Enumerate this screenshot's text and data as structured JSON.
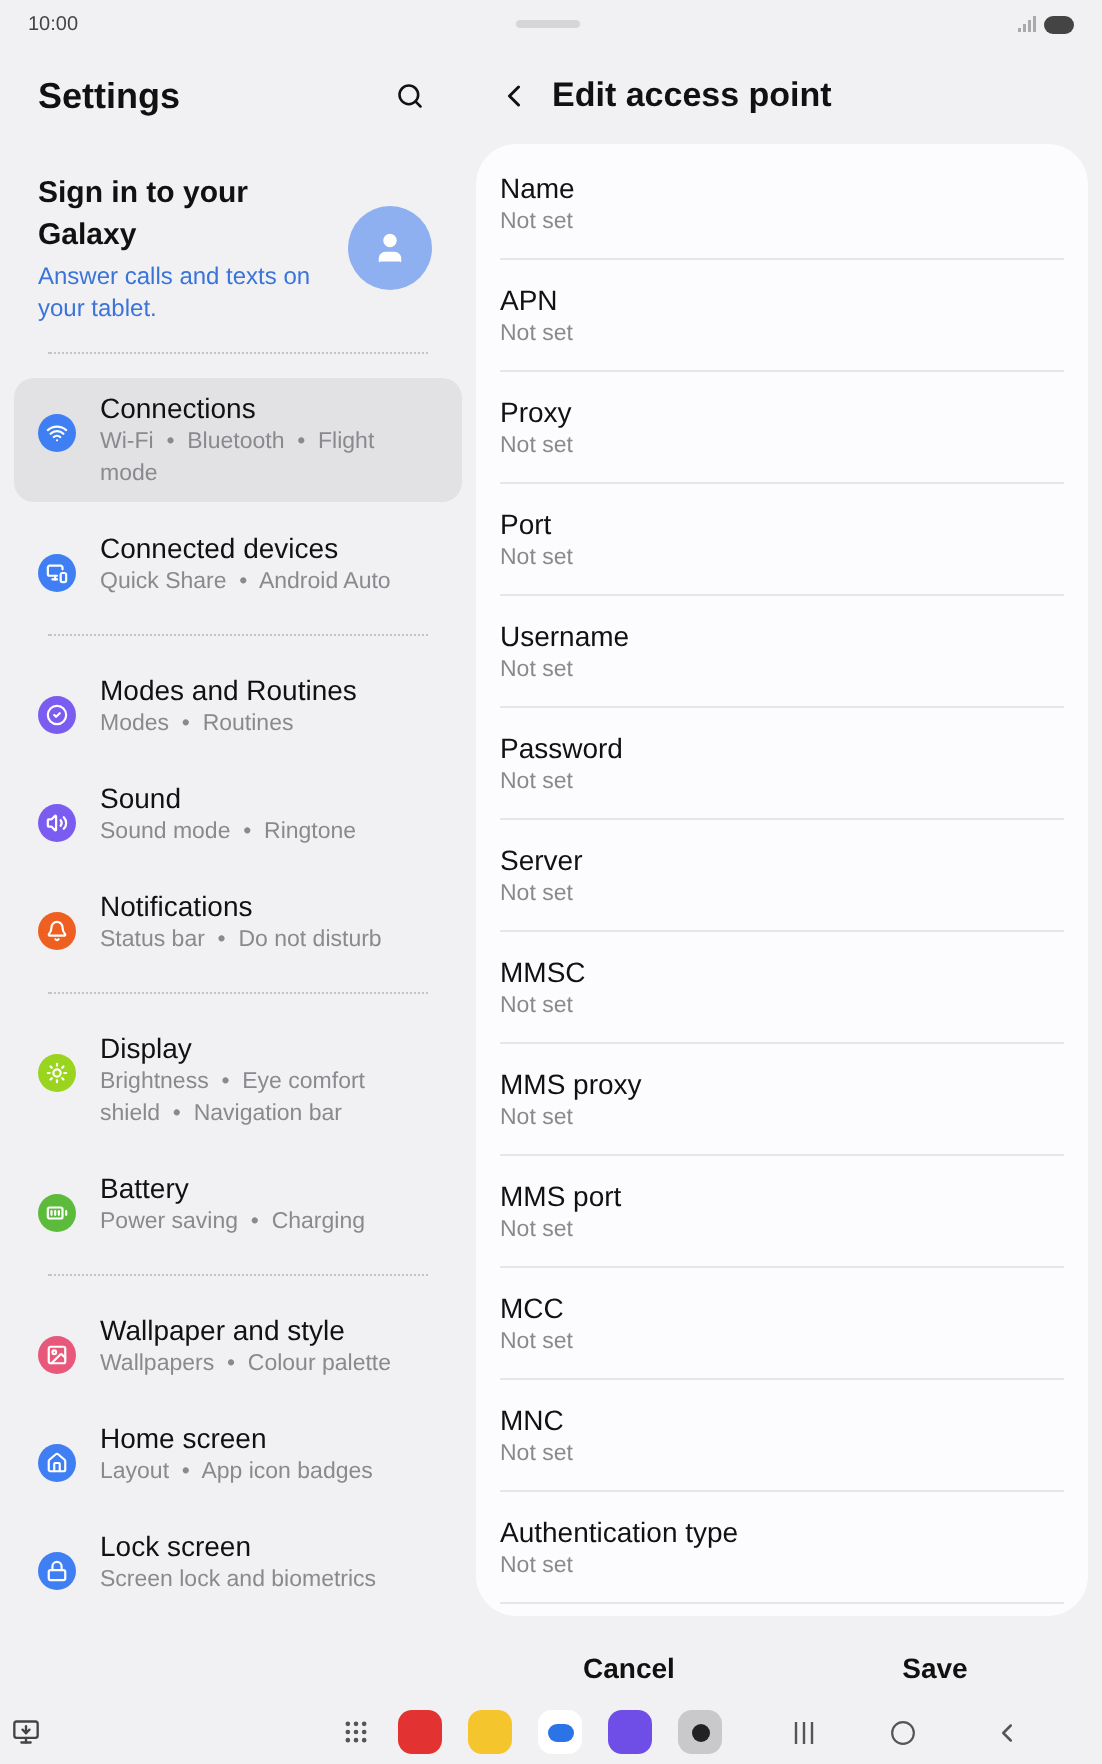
{
  "status_bar": {
    "time": "10:00"
  },
  "settings": {
    "title": "Settings",
    "account": {
      "title": "Sign in to your Galaxy",
      "subtitle": "Answer calls and texts on your tablet."
    },
    "groups": [
      [
        {
          "title": "Connections",
          "subtitle": "Wi-Fi  •  Bluetooth  •  Flight mode",
          "color": "#3f7ff3",
          "selected": true
        },
        {
          "title": "Connected devices",
          "subtitle": "Quick Share  •  Android Auto",
          "color": "#3f7ff3",
          "selected": false
        }
      ],
      [
        {
          "title": "Modes and Routines",
          "subtitle": "Modes  •  Routines",
          "color": "#7b5cf0",
          "selected": false
        },
        {
          "title": "Sound",
          "subtitle": "Sound mode  •  Ringtone",
          "color": "#7b5cf0",
          "selected": false
        },
        {
          "title": "Notifications",
          "subtitle": "Status bar  •  Do not disturb",
          "color": "#ef5f21",
          "selected": false
        }
      ],
      [
        {
          "title": "Display",
          "subtitle": "Brightness  •  Eye comfort shield  •  Navigation bar",
          "color": "#9ad41e",
          "selected": false
        },
        {
          "title": "Battery",
          "subtitle": "Power saving  •  Charging",
          "color": "#5dbb3b",
          "selected": false
        }
      ],
      [
        {
          "title": "Wallpaper and style",
          "subtitle": "Wallpapers  •  Colour palette",
          "color": "#e8587a",
          "selected": false
        },
        {
          "title": "Home screen",
          "subtitle": "Layout  •  App icon badges",
          "color": "#3f7ff3",
          "selected": false
        },
        {
          "title": "Lock screen",
          "subtitle": "Screen lock and biometrics",
          "color": "#3f7ff3",
          "selected": false
        }
      ]
    ]
  },
  "edit_access_point": {
    "title": "Edit access point",
    "fields": [
      {
        "label": "Name",
        "value": "Not set"
      },
      {
        "label": "APN",
        "value": "Not set"
      },
      {
        "label": "Proxy",
        "value": "Not set"
      },
      {
        "label": "Port",
        "value": "Not set"
      },
      {
        "label": "Username",
        "value": "Not set"
      },
      {
        "label": "Password",
        "value": "Not set"
      },
      {
        "label": "Server",
        "value": "Not set"
      },
      {
        "label": "MMSC",
        "value": "Not set"
      },
      {
        "label": "MMS proxy",
        "value": "Not set"
      },
      {
        "label": "MMS port",
        "value": "Not set"
      },
      {
        "label": "MCC",
        "value": "Not set"
      },
      {
        "label": "MNC",
        "value": "Not set"
      },
      {
        "label": "Authentication type",
        "value": "Not set"
      }
    ],
    "buttons": [
      "Cancel",
      "Save"
    ]
  }
}
